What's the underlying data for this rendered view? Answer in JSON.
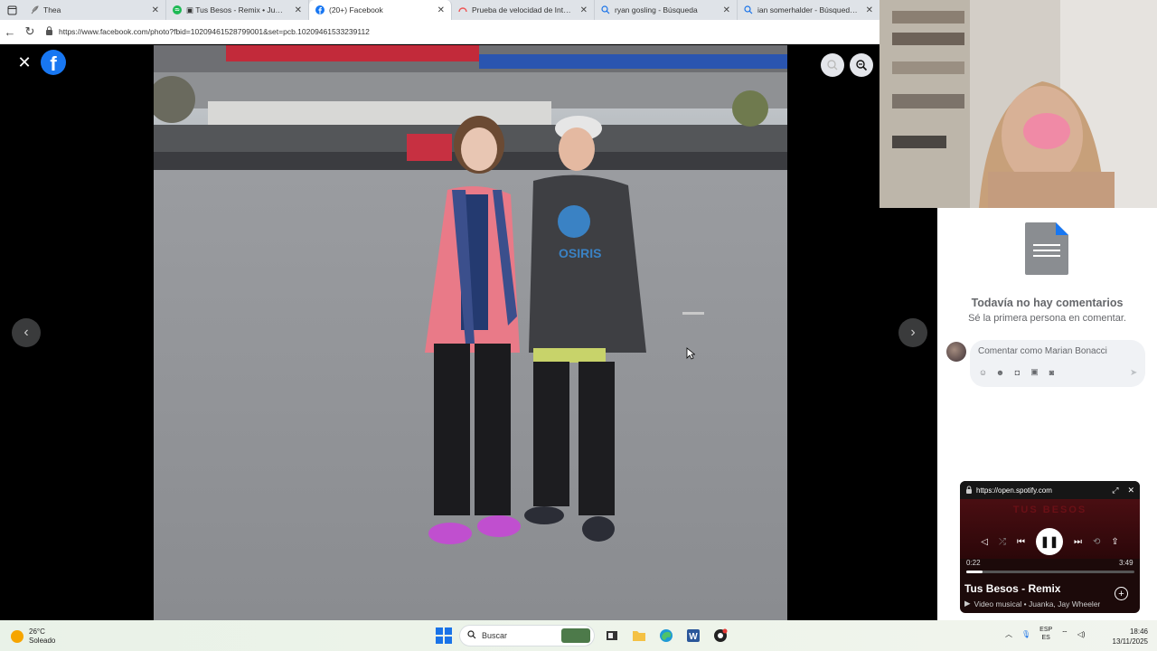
{
  "browser": {
    "tabs": [
      {
        "title": "Thea",
        "icon": "feather-icon",
        "active": false
      },
      {
        "title": "Tus Besos - Remix • Juanka...",
        "icon": "spotify-icon",
        "active": false
      },
      {
        "title": "(20+) Facebook",
        "icon": "facebook-icon",
        "active": true
      },
      {
        "title": "Prueba de velocidad de Internet...",
        "icon": "speedtest-icon",
        "active": false
      },
      {
        "title": "ryan gosling - Búsqueda",
        "icon": "search-icon",
        "active": false
      },
      {
        "title": "ian somerhalder - Búsqueda Imá...",
        "icon": "search-icon",
        "active": false
      }
    ],
    "url": "https://www.facebook.com/photo?fbid=10209461528799001&set=pcb.10209461533239112"
  },
  "facebook": {
    "logo_letter": "f",
    "comments": {
      "empty_title": "Todavía no hay comentarios",
      "empty_subtitle": "Sé la primera persona en comentar.",
      "input_placeholder": "Comentar como Marian Bonacci"
    }
  },
  "spotify": {
    "host": "https://open.spotify.com",
    "art_text": "TUS BESOS",
    "elapsed": "0:22",
    "duration": "3:49",
    "progress": 0.096,
    "track_title": "Tus Besos - Remix",
    "subtitle": "Video musical • Juanka, Jay Wheeler"
  },
  "taskbar": {
    "weather_temp": "26°C",
    "weather_desc": "Soleado",
    "search_placeholder": "Buscar",
    "lang_primary": "ESP",
    "lang_secondary": "ES",
    "time": "18:46",
    "date": "13/11/2025"
  },
  "colors": {
    "facebook_blue": "#1877f2",
    "viewer_bg": "#000000",
    "spotify_bg": "#1c0a0a"
  }
}
